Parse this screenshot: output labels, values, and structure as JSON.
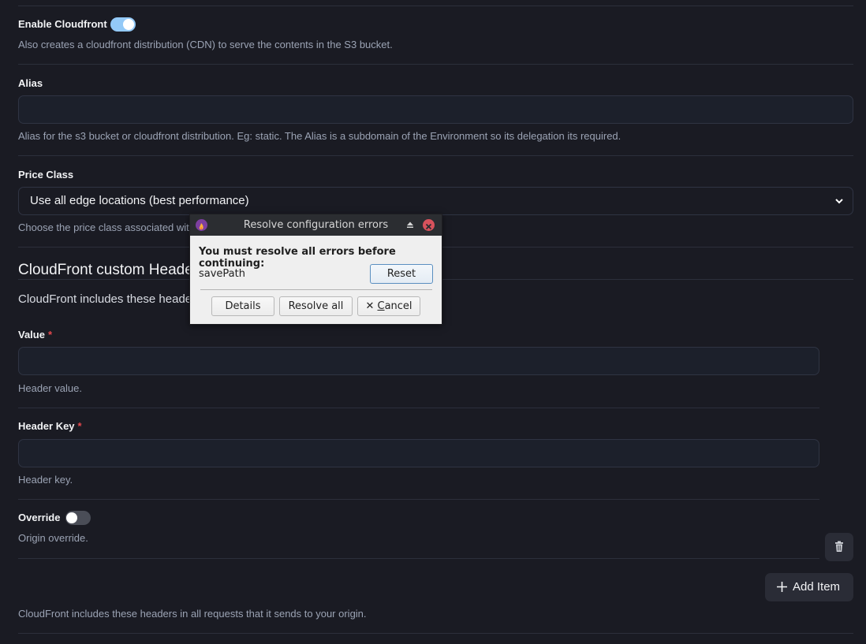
{
  "enable_cloudfront": {
    "label": "Enable Cloudfront",
    "enabled": true,
    "help": "Also creates a cloudfront distribution (CDN) to serve the contents in the S3 bucket."
  },
  "alias": {
    "label": "Alias",
    "value": "",
    "help": "Alias for the s3 bucket or cloudfront distribution. Eg: static. The Alias is a subdomain of the Environment so its delegation its required."
  },
  "price_class": {
    "label": "Price Class",
    "selected": "Use all edge locations (best performance)",
    "help": "Choose the price class associated with the CloudFront distribution."
  },
  "custom_headers": {
    "title": "CloudFront custom Headers",
    "subtitle": "CloudFront includes these headers in all requests that it sends to your origin.",
    "item": {
      "value_field": {
        "label": "Value",
        "required_mark": "*",
        "value": "",
        "help": "Header value."
      },
      "key_field": {
        "label": "Header Key",
        "required_mark": "*",
        "value": "",
        "help": "Header key."
      },
      "override": {
        "label": "Override",
        "enabled": false,
        "help": "Origin override."
      }
    },
    "delete_icon": "trash-icon",
    "add_item_label": "Add Item",
    "footer_help": "CloudFront includes these headers in all requests that it sends to your origin."
  },
  "dialog": {
    "title": "Resolve configuration errors",
    "message": "You must resolve all errors before continuing:",
    "errors": [
      {
        "name": "savePath",
        "action": "Reset"
      }
    ],
    "buttons": {
      "details": "Details",
      "resolve_all": "Resolve all",
      "cancel_mnemonic": "C",
      "cancel_rest": "ancel"
    },
    "icons": {
      "app": "flame-app-icon",
      "eject": "eject-icon",
      "close": "close-icon"
    }
  },
  "colors": {
    "accent_toggle": "#93c9f7",
    "required": "#e5484d",
    "background": "#1a1b23"
  }
}
